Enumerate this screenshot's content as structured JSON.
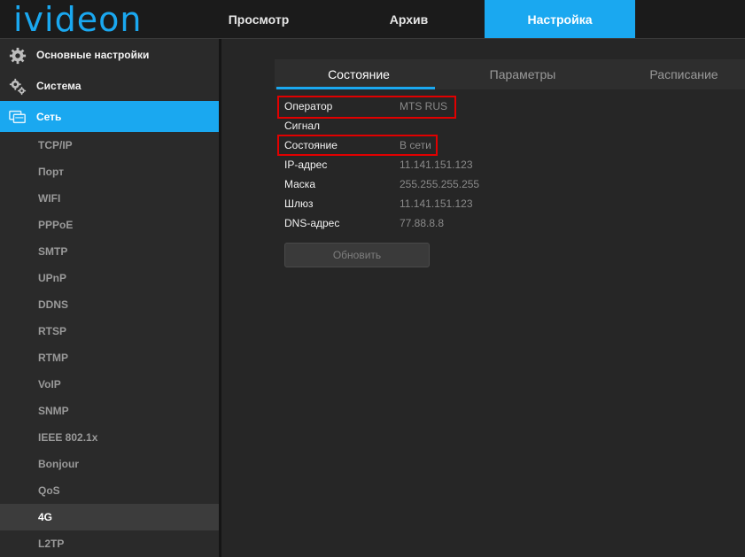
{
  "logo": "ivideon",
  "nav": {
    "tabs": [
      "Просмотр",
      "Архив",
      "Настройка"
    ],
    "active": "Настройка"
  },
  "sidebar": {
    "sections": [
      {
        "label": "Основные настройки",
        "icon": "gear-icon"
      },
      {
        "label": "Система",
        "icon": "gears-icon"
      },
      {
        "label": "Сеть",
        "icon": "network-icon"
      }
    ],
    "items": [
      "TCP/IP",
      "Порт",
      "WIFI",
      "PPPoE",
      "SMTP",
      "UPnP",
      "DDNS",
      "RTSP",
      "RTMP",
      "VoIP",
      "SNMP",
      "IEEE 802.1x",
      "Bonjour",
      "QoS",
      "4G",
      "L2TP"
    ],
    "active_item": "4G"
  },
  "subtabs": [
    "Состояние",
    "Параметры",
    "Расписание"
  ],
  "status": {
    "rows": [
      {
        "key": "Оператор",
        "value": "MTS RUS"
      },
      {
        "key": "Сигнал",
        "value": ""
      },
      {
        "key": "Состояние",
        "value": "В сети"
      },
      {
        "key": "IP-адрес",
        "value": "11.141.151.123"
      },
      {
        "key": "Маска",
        "value": "255.255.255.255"
      },
      {
        "key": "Шлюз",
        "value": "11.141.151.123"
      },
      {
        "key": "DNS-адрес",
        "value": "77.88.8.8"
      }
    ]
  },
  "refresh_button": "Обновить",
  "colors": {
    "accent": "#1aa8f0",
    "highlight": "#e10000"
  }
}
